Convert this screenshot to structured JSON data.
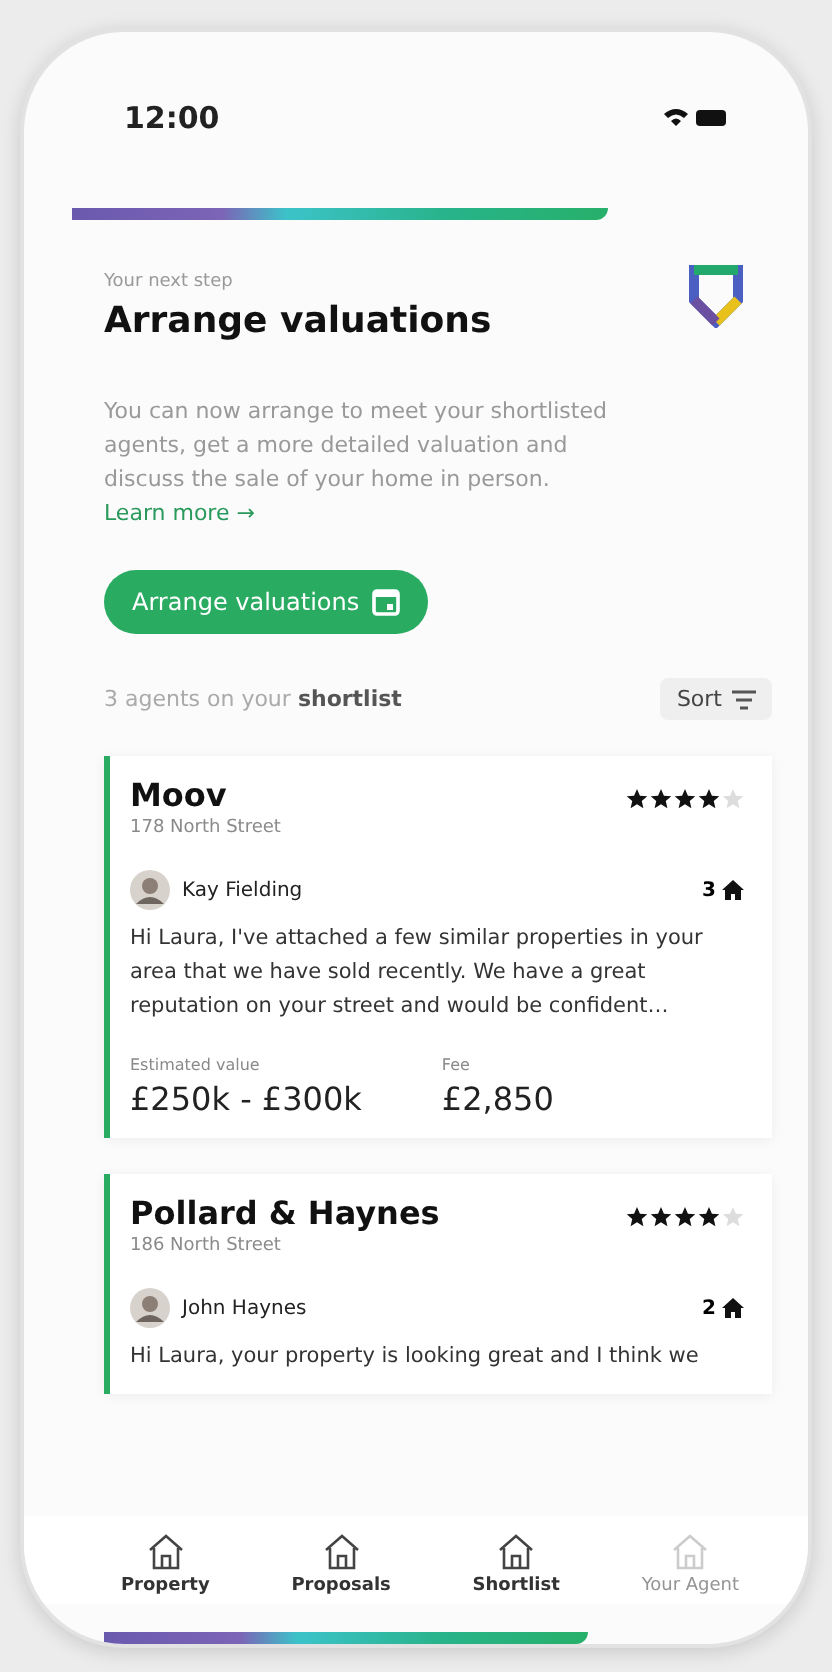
{
  "status_bar": {
    "time": "12:00"
  },
  "header": {
    "eyebrow": "Your next step",
    "title": "Arrange valuations",
    "body": "You can now arrange to meet your shortlisted agents, get a more detailed valuation and discuss the sale of your home in person.",
    "link": "Learn more →"
  },
  "cta_button": {
    "label": "Arrange valuations"
  },
  "shortlist": {
    "count_text": "3 agents on your **shortlist**",
    "sort_label": "Sort"
  },
  "agents": [
    {
      "name": "Moov",
      "address": "178 North Street",
      "stars": 4,
      "contact": "Kay Fielding",
      "properties": "3",
      "message": "Hi Laura, I've attached a few similar properties in your area that we have sold recently. We have a great reputation on your street and would be confident…",
      "value_label": "Estimated value",
      "value": "£250k - £300k",
      "fee_label": "Fee",
      "fee": "£2,850"
    },
    {
      "name": "Pollard & Haynes",
      "address": "186 North Street",
      "stars": 4,
      "contact": "John Haynes",
      "properties": "2",
      "message": "Hi Laura, your property is looking great and I think we"
    }
  ],
  "tab_bar": [
    {
      "label": "Property",
      "disabled": false
    },
    {
      "label": "Proposals",
      "disabled": false
    },
    {
      "label": "Shortlist",
      "disabled": false
    },
    {
      "label": "Your Agent",
      "disabled": true
    }
  ]
}
